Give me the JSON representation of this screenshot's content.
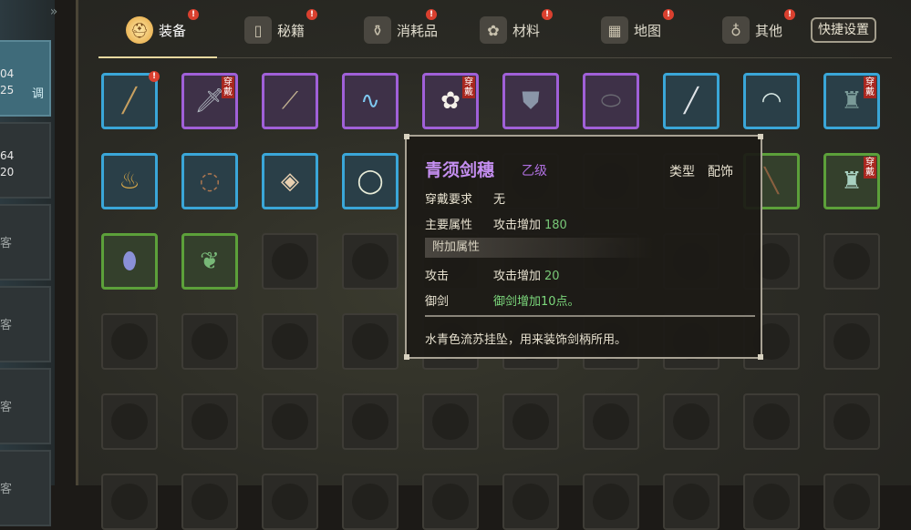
{
  "left_panel": {
    "cards": [
      {
        "n1": "04",
        "n2": "25",
        "tag": "调",
        "active": true
      },
      {
        "n1": "64",
        "n2": "20",
        "tag": "",
        "active": false
      },
      {
        "ch": "客"
      },
      {
        "ch": "客"
      },
      {
        "ch": "客"
      },
      {
        "ch": "客"
      }
    ]
  },
  "tabs": [
    {
      "label": "装备",
      "icon": "helmet-icon",
      "alert": "!",
      "active": true
    },
    {
      "label": "秘籍",
      "icon": "book-icon",
      "alert": "!"
    },
    {
      "label": "消耗品",
      "icon": "potion-icon",
      "alert": "!"
    },
    {
      "label": "材料",
      "icon": "herb-icon",
      "alert": "!"
    },
    {
      "label": "地图",
      "icon": "map-icon",
      "alert": "!"
    },
    {
      "label": "其他",
      "icon": "misc-icon",
      "alert": "!"
    }
  ],
  "quick_settings_label": "快捷设置",
  "equipped_tag": "穿戴",
  "alert_mark": "!",
  "inventory": [
    {
      "icon": "spear-icon",
      "quality": "blue",
      "alert": true
    },
    {
      "icon": "broadsword-icon",
      "quality": "purple",
      "equipped": true
    },
    {
      "icon": "halberd-icon",
      "quality": "purple"
    },
    {
      "icon": "blue-sash-icon",
      "quality": "purple"
    },
    {
      "icon": "white-flower-icon",
      "quality": "purple",
      "equipped": true
    },
    {
      "icon": "tabard-icon",
      "quality": "purple"
    },
    {
      "icon": "round-shield-icon",
      "quality": "purple"
    },
    {
      "icon": "sword-icon",
      "quality": "blue"
    },
    {
      "icon": "folding-fan-icon",
      "quality": "blue"
    },
    {
      "icon": "robe-icon",
      "quality": "blue",
      "equipped": true
    },
    {
      "icon": "gold-pouch-icon",
      "quality": "blue"
    },
    {
      "icon": "prayer-beads-icon",
      "quality": "blue"
    },
    {
      "icon": "jade-pendant-icon",
      "quality": "blue"
    },
    {
      "icon": "jade-bracelet-icon",
      "quality": "blue"
    },
    {
      "icon": "",
      "quality": "none"
    },
    {
      "icon": "",
      "quality": "none"
    },
    {
      "icon": "",
      "quality": "none"
    },
    {
      "icon": "",
      "quality": "none"
    },
    {
      "icon": "staff-icon",
      "quality": "green"
    },
    {
      "icon": "green-robe-icon",
      "quality": "green",
      "equipped": true
    },
    {
      "icon": "mirror-icon",
      "quality": "green"
    },
    {
      "icon": "leaf-bundle-icon",
      "quality": "green"
    }
  ],
  "tooltip": {
    "name": "青须剑穗",
    "grade": "乙级",
    "type_label": "类型",
    "type_value": "配饰",
    "requirement_label": "穿戴要求",
    "requirement_value": "无",
    "main_attr_label": "主要属性",
    "main_attr_value": "攻击增加",
    "main_attr_num": "180",
    "extra_section": "附加属性",
    "extra1_label": "攻击",
    "extra1_value": "攻击增加",
    "extra1_num": "20",
    "extra2_label": "御剑",
    "extra2_value": "御剑增加10点。",
    "description": "水青色流苏挂坠，用来装饰剑柄所用。"
  },
  "colors": {
    "quality_blue": "#3aa6d8",
    "quality_purple": "#a060d8",
    "quality_green": "#5ca03a",
    "alert_red": "#d9402f",
    "item_name_purple": "#c48ef0",
    "bonus_green": "#78c878"
  }
}
